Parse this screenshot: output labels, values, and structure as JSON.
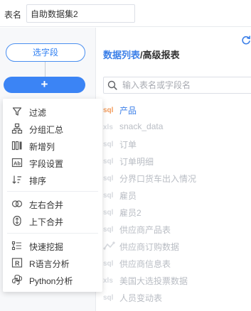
{
  "header": {
    "name_label": "表名",
    "name_value": "自助数据集2"
  },
  "canvas": {
    "select_field_label": "选字段",
    "add_label": "+"
  },
  "menu": {
    "items": [
      {
        "label": "过滤",
        "icon": "filter-icon"
      },
      {
        "label": "分组汇总",
        "icon": "group-summary-icon"
      },
      {
        "label": "新增列",
        "icon": "add-column-icon"
      },
      {
        "label": "字段设置",
        "icon": "field-settings-icon"
      },
      {
        "label": "排序",
        "icon": "sort-icon"
      },
      {
        "label": "左右合并",
        "icon": "horizontal-merge-icon"
      },
      {
        "label": "上下合并",
        "icon": "vertical-merge-icon"
      },
      {
        "label": "快速挖掘",
        "icon": "quick-mining-icon"
      },
      {
        "label": "R语言分析",
        "icon": "r-language-icon"
      },
      {
        "label": "Python分析",
        "icon": "python-icon"
      }
    ]
  },
  "panel": {
    "title_main": "数据列表",
    "title_sep": "/",
    "title_sub": "高级报表",
    "search_placeholder": "输入表名或字段名",
    "tables": [
      {
        "label": "产品",
        "icon": "sql-icon",
        "active": true
      },
      {
        "label": "snack_data",
        "icon": "xls-icon"
      },
      {
        "label": "订单",
        "icon": "sql-icon"
      },
      {
        "label": "订单明细",
        "icon": "sql-icon"
      },
      {
        "label": "分界口货车出入情况",
        "icon": "sql-icon"
      },
      {
        "label": "雇员",
        "icon": "sql-icon"
      },
      {
        "label": "雇员2",
        "icon": "sql-icon"
      },
      {
        "label": "供应商产品表",
        "icon": "sql-icon"
      },
      {
        "label": "供应商订购数据",
        "icon": "etl-icon"
      },
      {
        "label": "供应商信息表",
        "icon": "sql-icon"
      },
      {
        "label": "美国大选投票数据",
        "icon": "xls-icon"
      },
      {
        "label": "人员变动表",
        "icon": "sql-icon"
      }
    ]
  },
  "colors": {
    "accent": "#3b84f5",
    "link": "#3b7fe8",
    "sql_active": "#f29b5b",
    "muted": "#b9bdc4"
  }
}
